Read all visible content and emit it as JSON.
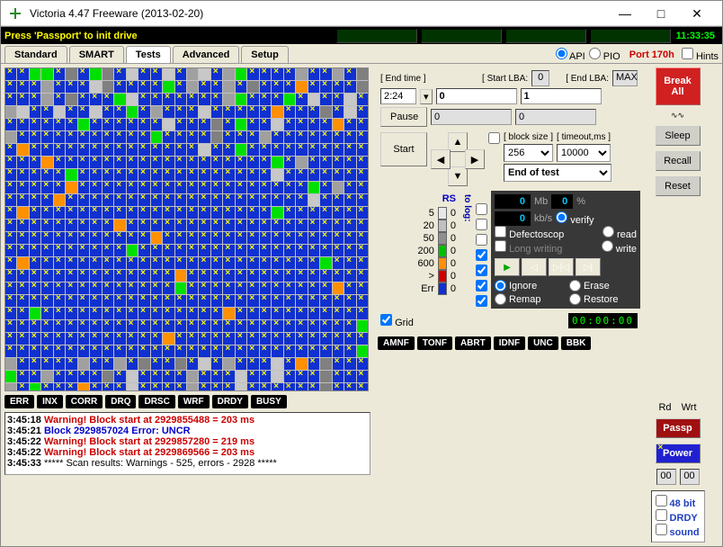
{
  "window": {
    "title": "Victoria 4.47  Freeware (2013-02-20)"
  },
  "status": {
    "msg": "Press 'Passport' to init drive",
    "clock": "11:33:35"
  },
  "tabs": [
    "Standard",
    "SMART",
    "Tests",
    "Advanced",
    "Setup"
  ],
  "active_tab": 2,
  "topright": {
    "api": "API",
    "pio": "PIO",
    "port": "Port 170h",
    "hints": "Hints"
  },
  "lba": {
    "end_time_lbl": "[ End time ]",
    "end_time": "2:24",
    "start_lba_lbl": "[ Start LBA:",
    "start_lba_badge": "0",
    "start_lba": "0",
    "end_lba_lbl": "[ End LBA:",
    "end_lba_max": "MAX",
    "end_lba": "1",
    "ro1": "0",
    "ro2": "0",
    "pause": "Pause",
    "start": "Start",
    "block_lbl": "[ block size ]",
    "block": "256",
    "timeout_lbl": "[ timeout,ms ]",
    "timeout": "10000",
    "action": "End of test"
  },
  "legend": {
    "rs": "RS",
    "items": [
      {
        "t": "5",
        "c": "#e8e8e8",
        "v": "0"
      },
      {
        "t": "20",
        "c": "#c0c0c0",
        "v": "0"
      },
      {
        "t": "50",
        "c": "#909090",
        "v": "0"
      },
      {
        "t": "200",
        "c": "#00c000",
        "v": "0"
      },
      {
        "t": "600",
        "c": "#ff9000",
        "v": "0"
      },
      {
        "t": ">",
        "c": "#d00000",
        "v": "0"
      },
      {
        "t": "Err",
        "c": "#1030d0",
        "v": "0"
      }
    ],
    "tolog": "to log:"
  },
  "stats": {
    "mb": "0",
    "mb_u": "Mb",
    "pct": "0",
    "pct_u": "%",
    "kbs": "0",
    "kbs_u": "kb/s",
    "verify": "verify",
    "read": "read",
    "write": "write",
    "defect": "Defectoscop",
    "longwr": "Long writing"
  },
  "mode": {
    "ignore": "Ignore",
    "erase": "Erase",
    "remap": "Remap",
    "restore": "Restore",
    "grid": "Grid",
    "timer": "00:00:00"
  },
  "side": {
    "break": "Break All",
    "sleep": "Sleep",
    "recall": "Recall",
    "reset": "Reset",
    "rd": "Rd",
    "wrt": "Wrt",
    "passp": "Passp",
    "power": "Power",
    "d1": "00",
    "d2": "00"
  },
  "flags1": [
    "ERR",
    "INX",
    "CORR",
    "DRQ",
    "DRSC",
    "WRF",
    "DRDY",
    "BUSY"
  ],
  "flags2": [
    "AMNF",
    "TONF",
    "ABRT",
    "IDNF",
    "UNC",
    "BBK"
  ],
  "opts": [
    "48 bit",
    "DRDY",
    "sound"
  ],
  "log": [
    {
      "ts": "3:45:18",
      "cls": "warn",
      "txt": "Warning! Block start at 2929855488 = 203 ms"
    },
    {
      "ts": "3:45:21",
      "cls": "err",
      "txt": "Block 2929857024 Error: UNCR"
    },
    {
      "ts": "3:45:22",
      "cls": "warn",
      "txt": "Warning! Block start at 2929857280 = 219 ms"
    },
    {
      "ts": "3:45:22",
      "cls": "warn",
      "txt": "Warning! Block start at 2929869566 = 203 ms"
    },
    {
      "ts": "3:45:33",
      "cls": "",
      "txt": "***** Scan results: Warnings - 525, errors - 2928 *****"
    }
  ],
  "grid_pattern": "bbggb.bg.b.bb.b..b.gbbbb.bb.b.bbb.bbb..bbbbgb.bb.b.bbbobbbb.bbb.b.bbbg.bbbbbbb.gbbbgb.bb.b..bb.bb.bbgb.bbb.bbbbbobbb.b.bbbbbbbgbbbbbb.bbb.bgbb.bbbbobb.bbbbbbbbbbbgbbbb.bbb.bbbbbbbbbobbbbbbbbbbbbbb.bbgbbbbbbbbbbbbbobbbbbbbbbbbbbbbbbbgb.bbbbbbbbbbgbbbbbbbbbbbbbbbb.bbbbbbbbbbbbobbbbbbbbbbbbbbbbbbbgb.bbbbbbobbbbbbbbbbbbbbbbbbbb.bbbbbobbbbbbbbbbbbbbbbbbbbgbbbbbbbbbbbbbbbbobbbbbbbbbbbbbbbbbbbbbbbbbbbbbbbbobbbbbbbbbbbbbbbbbbbbbbbbbbbgbbbbbbbbbbbbbbbbbbbbobbbbbbbbbbbbbbbbbbbbbbbbgbbbbbbbbbbbbbbbbbobbbbbbbbbbbbbbbbbbbbbbbbbbbbbgbbbbbbbbbbbbobbbbbbbbbbbbbbbbbbbbbbbbbbbbbbbbbbgbbbbbbbbbbbbbbbobbbbbbbbbbbbbbbbbbbbbbbbbbbbbbbbbbbbbbbbgbbbbbbbbbbbbbobbbbbbbbbbbbbbbbbbbbbbbbbbbbbbbbbbbbbbbbbbbbbg.bbbbb.bb.b.bb.b.b.bbb.bob.bbbgbb.bbbb.b.bbbb.bbb.bb.bbb.bbb.bgbbbobbb.bbbb.bbb.bbbbbb.bbb...........g........"
}
